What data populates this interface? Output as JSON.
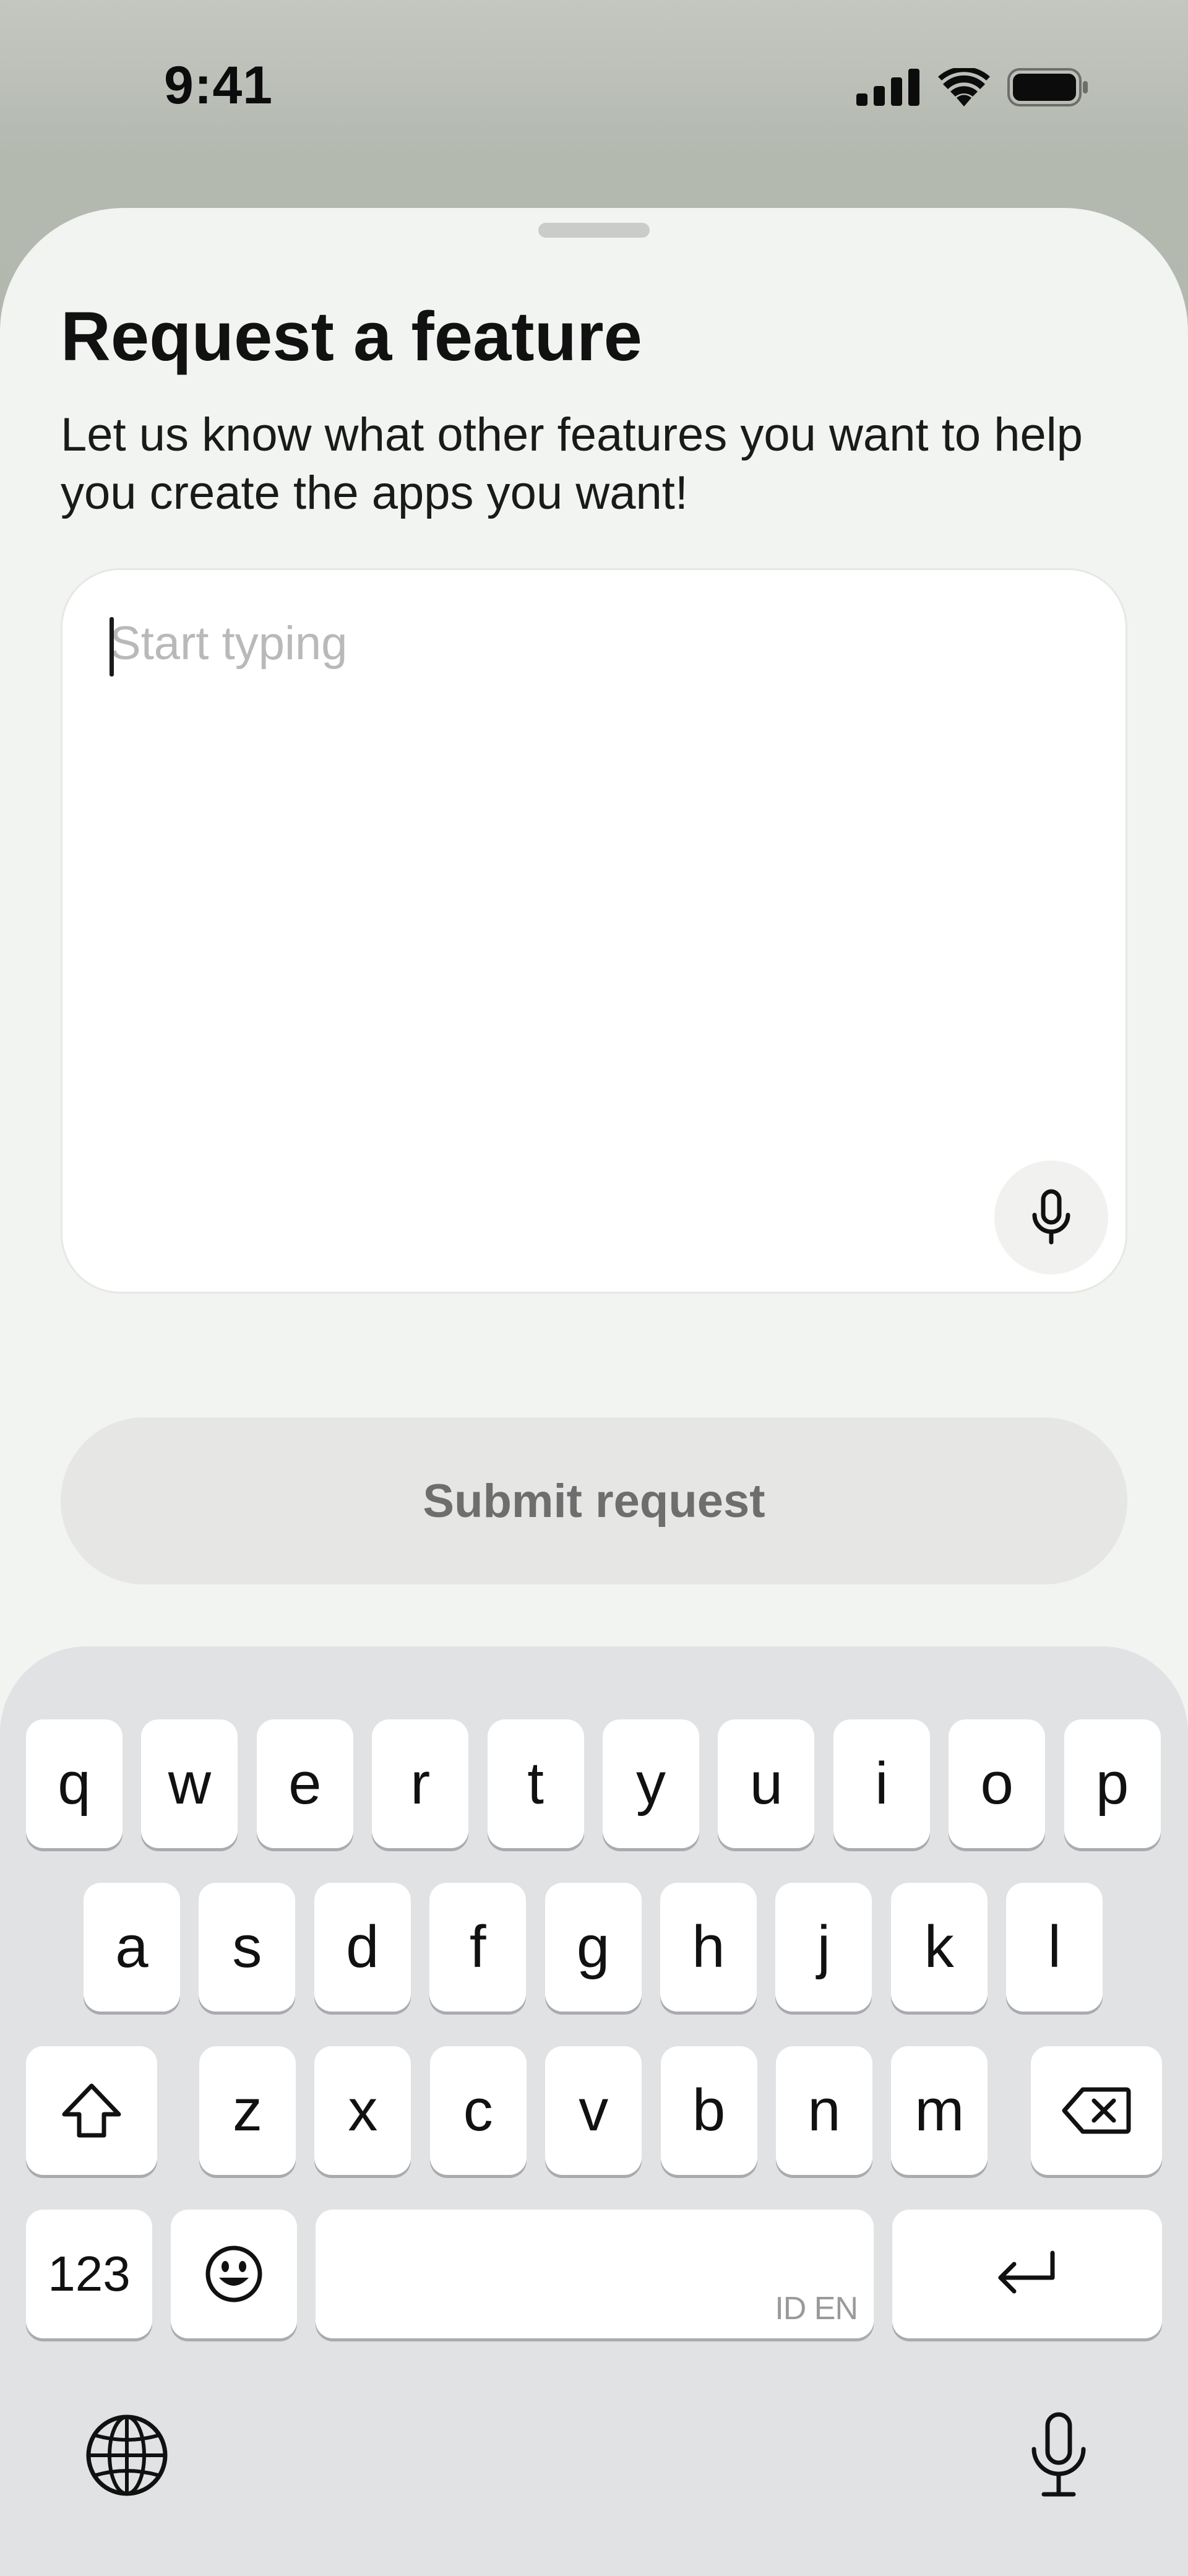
{
  "status_bar": {
    "time": "9:41"
  },
  "sheet": {
    "title": "Request a feature",
    "subtitle": "Let us know what other features you want to help you create the apps you want!",
    "input": {
      "placeholder": "Start typing",
      "value": ""
    },
    "submit_label": "Submit request"
  },
  "keyboard": {
    "row1": [
      "q",
      "w",
      "e",
      "r",
      "t",
      "y",
      "u",
      "i",
      "o",
      "p"
    ],
    "row2": [
      "a",
      "s",
      "d",
      "f",
      "g",
      "h",
      "j",
      "k",
      "l"
    ],
    "row3": [
      "z",
      "x",
      "c",
      "v",
      "b",
      "n",
      "m"
    ],
    "numbers_label": "123",
    "space_language_hint": "ID EN"
  },
  "icons": {
    "signal": "cellular-signal-icon",
    "wifi": "wifi-icon",
    "battery": "battery-icon",
    "mic": "microphone-icon",
    "shift": "shift-icon",
    "delete": "backspace-icon",
    "emoji": "emoji-icon",
    "return": "return-icon",
    "globe": "globe-icon",
    "dictation": "dictation-mic-icon"
  }
}
